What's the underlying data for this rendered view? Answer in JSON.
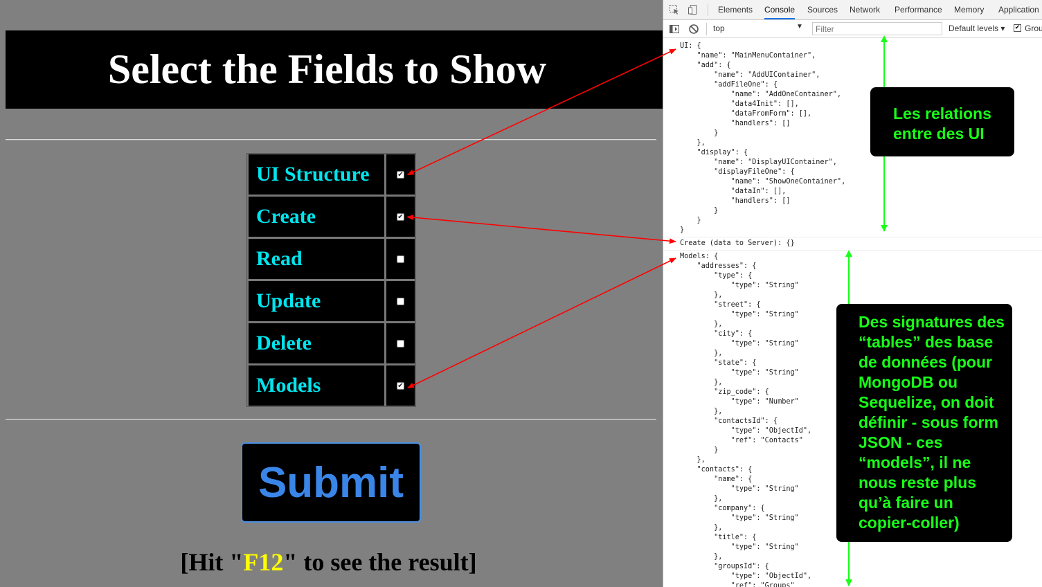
{
  "left": {
    "title": "Select the Fields to Show",
    "fields": [
      {
        "label": "UI Structure",
        "checked": true
      },
      {
        "label": "Create",
        "checked": true
      },
      {
        "label": "Read",
        "checked": false
      },
      {
        "label": "Update",
        "checked": false
      },
      {
        "label": "Delete",
        "checked": false
      },
      {
        "label": "Models",
        "checked": true
      }
    ],
    "submit_label": "Submit",
    "hint": {
      "prefix": "[Hit \"",
      "key": "F12",
      "suffix": "\" to see the result]"
    }
  },
  "devtools": {
    "tabs": [
      "Elements",
      "Console",
      "Sources",
      "Network",
      "Performance",
      "Memory",
      "Application"
    ],
    "active_tab": "Console",
    "context": "top",
    "filter_placeholder": "Filter",
    "levels": "Default levels ▾",
    "group_label": "Grou",
    "console": {
      "ui_log": "UI: {\n    \"name\": \"MainMenuContainer\",\n    \"add\": {\n        \"name\": \"AddUIContainer\",\n        \"addFileOne\": {\n            \"name\": \"AddOneContainer\",\n            \"data4Init\": [],\n            \"dataFromForm\": [],\n            \"handlers\": []\n        }\n    },\n    \"display\": {\n        \"name\": \"DisplayUIContainer\",\n        \"displayFileOne\": {\n            \"name\": \"ShowOneContainer\",\n            \"dataIn\": [],\n            \"handlers\": []\n        }\n    }\n}",
      "create_log": "Create (data to Server): {}",
      "models_log": "Models: {\n    \"addresses\": {\n        \"type\": {\n            \"type\": \"String\"\n        },\n        \"street\": {\n            \"type\": \"String\"\n        },\n        \"city\": {\n            \"type\": \"String\"\n        },\n        \"state\": {\n            \"type\": \"String\"\n        },\n        \"zip_code\": {\n            \"type\": \"Number\"\n        },\n        \"contactsId\": {\n            \"type\": \"ObjectId\",\n            \"ref\": \"Contacts\"\n        }\n    },\n    \"contacts\": {\n        \"name\": {\n            \"type\": \"String\"\n        },\n        \"company\": {\n            \"type\": \"String\"\n        },\n        \"title\": {\n            \"type\": \"String\"\n        },\n        \"groupsId\": {\n            \"type\": \"ObjectId\",\n            \"ref\": \"Groups\""
    }
  },
  "annotations": {
    "note_ui": "Les relations entre des UI",
    "note_models": "Des signatures des “tables” des base de données (pour MongoDB ou Sequelize, on doit définir - sous form JSON - ces “models”, il ne nous reste plus qu’à faire un copier-coller)"
  },
  "colors": {
    "field_text": "#00e5ee",
    "submit_text": "#3a86e8",
    "hint_key": "#ffff00",
    "note_text": "#18ff18",
    "arrow_red": "#ff0000",
    "arrow_green": "#18ff18"
  },
  "icons": [
    "inspect-icon",
    "device-toolbar-icon",
    "sidebar-icon",
    "clear-console-icon"
  ]
}
